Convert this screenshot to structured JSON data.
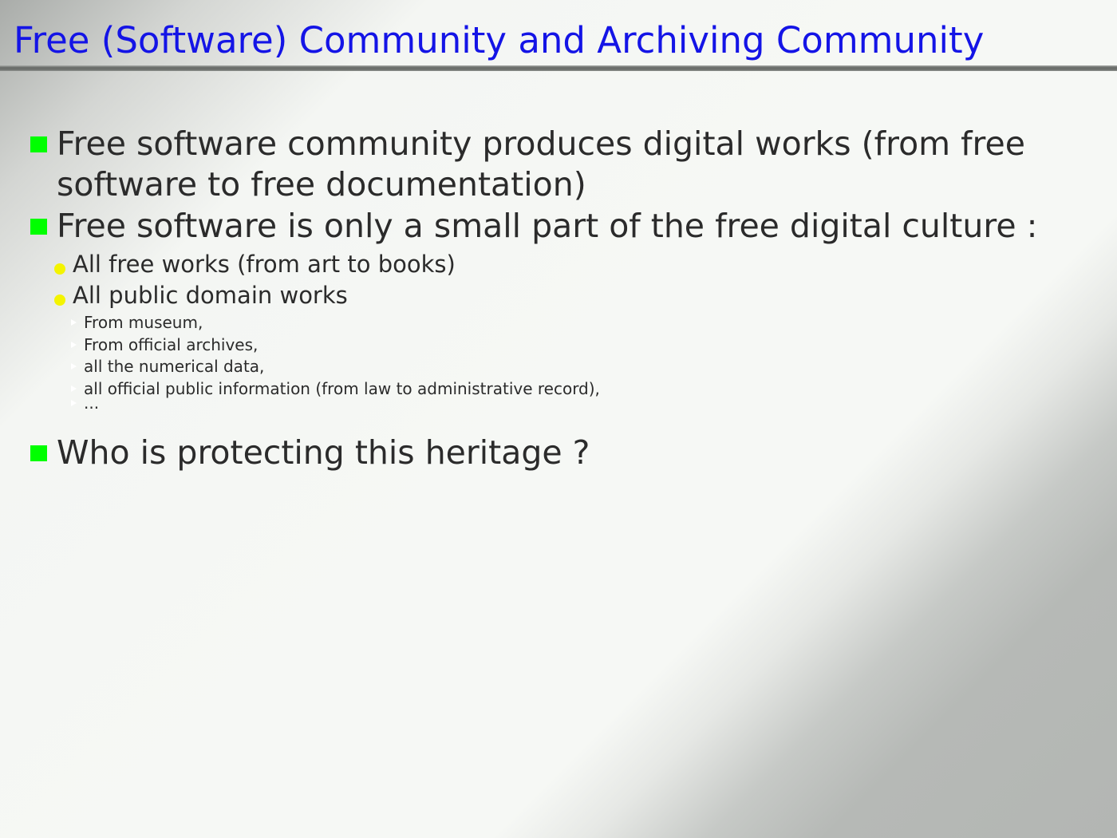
{
  "slide": {
    "title": "Free (Software) Community and Archiving Community",
    "bullets": [
      "Free software community produces digital works (from free software to free documentation)",
      "Free software is only a small part of the free digital culture :",
      "Who is protecting this heritage ?"
    ],
    "sub_bullets": [
      "All free works (from art to books)",
      "All public domain works"
    ],
    "sub_sub_bullets": [
      "From museum,",
      "From official archives,",
      "all the numerical data,",
      "all official public information (from law to administrative record),",
      "..."
    ],
    "colors": {
      "title": "#1414e6",
      "bullet_square": "#00ff00",
      "bullet_dot": "#f4f400",
      "bullet_triangle": "#ffffff",
      "body_text": "#2b2b2b"
    },
    "icons": {
      "level1": "green-square-bullet-icon",
      "level2": "yellow-dot-bullet-icon",
      "level3": "triangle-bullet-icon"
    }
  }
}
